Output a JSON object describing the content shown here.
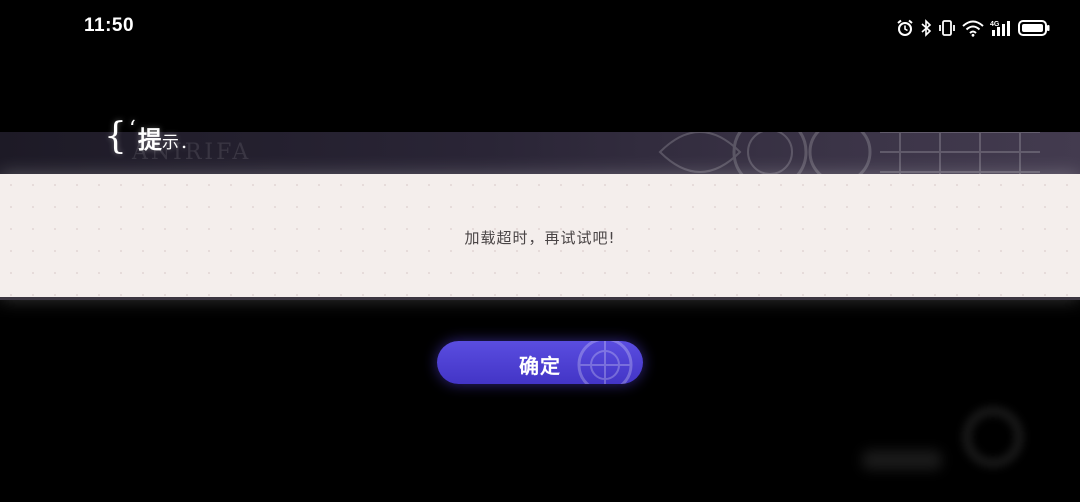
{
  "status_bar": {
    "time": "11:50",
    "icons": [
      "alarm-icon",
      "bluetooth-icon",
      "vibrate-icon",
      "wifi-icon",
      "4g-signal-icon",
      "battery-icon"
    ]
  },
  "dialog": {
    "title_brace": "{",
    "title_quote": "‘",
    "title_big": "提",
    "title_small": "示",
    "title_dot": ".",
    "message": "加载超时，再试试吧!",
    "confirm_label": "确定"
  },
  "colors": {
    "panel_background": "#f4eeec",
    "title_band": "#2a2536",
    "button": "#4a3dd4",
    "message_text": "#4a4546"
  }
}
